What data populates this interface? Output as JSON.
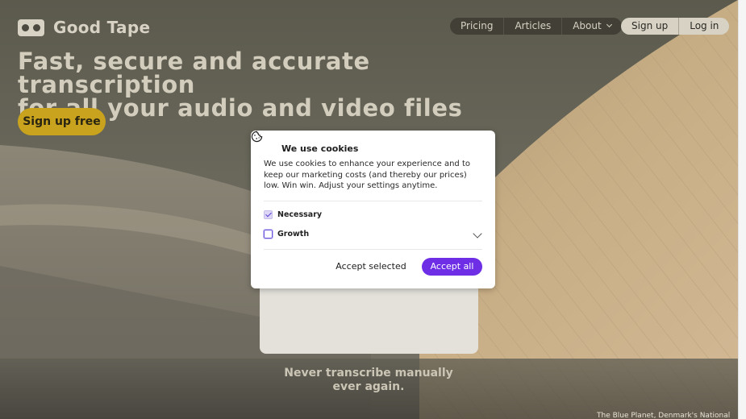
{
  "brand": {
    "name": "Good Tape",
    "logo_icon": "tape-logo-icon"
  },
  "nav": {
    "items": [
      {
        "label": "Pricing"
      },
      {
        "label": "Articles"
      },
      {
        "label": "About",
        "icon": "chevron-down-icon"
      }
    ]
  },
  "auth": {
    "signup_label": "Sign up",
    "login_label": "Log in"
  },
  "hero": {
    "headline_line1": "Fast, secure and accurate transcription",
    "headline_line2": "for all your audio and video files",
    "cta_label": "Sign up free",
    "tagline_line1": "Never transcribe manually",
    "tagline_line2": "ever again.",
    "caption": "The Blue Planet, Denmark's National"
  },
  "cookie_modal": {
    "icon": "cookie-icon",
    "title": "We use cookies",
    "body": "We use cookies to enhance your experience and to keep our marketing costs (and thereby our prices) low. Win win. Adjust your settings anytime.",
    "options": [
      {
        "label": "Necessary",
        "checked": true
      },
      {
        "label": "Growth",
        "checked": false
      }
    ],
    "accept_selected_label": "Accept selected",
    "accept_all_label": "Accept all"
  },
  "colors": {
    "accent": "#6d2ee6",
    "cta": "#c9a31d",
    "text_light": "#d7d2c4"
  }
}
